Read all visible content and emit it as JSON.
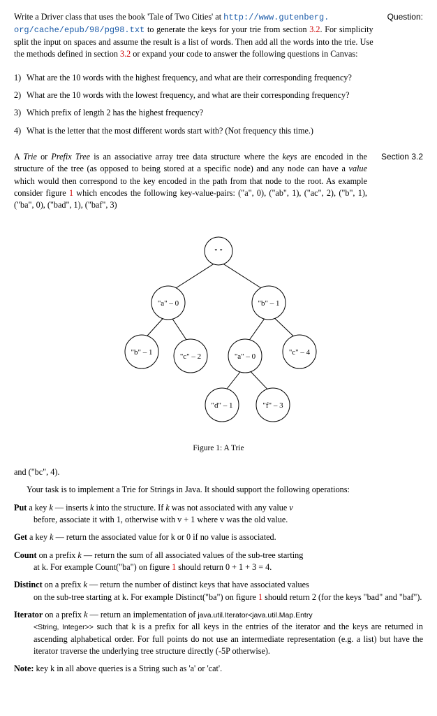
{
  "labels": {
    "question": "Question:",
    "section": "Section 3.2"
  },
  "intro": {
    "p1a": "Write a Driver class that uses the book 'Tale of Two Cities' at ",
    "url1": "http://www.gutenberg.",
    "url2": "org/cache/epub/98/pg98.txt",
    "p1b": " to generate the keys for your trie from section ",
    "ref": "3.2",
    "p1c": ". For simplicity split the input on spaces and assume the result is a list of words. Then add all the words into the trie. Use the methods defined in section ",
    "p1d": " or expand your code to answer the following questions in Canvas:"
  },
  "questions": {
    "q1n": "1)",
    "q1": "What are the 10 words with the highest frequency, and what are their corresponding frequency?",
    "q2n": "2)",
    "q2": "What are the 10 words with the lowest frequency, and what are their corresponding frequency?",
    "q3n": "3)",
    "q3": "Which prefix of length 2 has the highest frequency?",
    "q4n": "4)",
    "q4": "What is the letter that the most different words start with? (Not frequency this time.)"
  },
  "section32": {
    "p1a": "A ",
    "trie_it": "Trie",
    "p1b": " or ",
    "prefix_it": "Prefix Tree",
    "p1c": " is an associative array tree data structure where the ",
    "keys_it": "keys",
    "p1d": " are encoded in the structure of the tree (as opposed to being stored at a specific node) and any node can have a ",
    "value_it": "value",
    "p1e": " which would then correspond to the key encoded in the path from that node to the root. As example consider figure ",
    "fig_ref": "1",
    "p1f": " which encodes the following key-value-pairs: (\"a\", 0), (\"ab\", 1), (\"ac\", 2), (\"b\", 1), (\"ba\", 0), (\"bad\", 1), (\"baf\", 3)"
  },
  "figure": {
    "caption": "Figure 1: A Trie",
    "nodes": {
      "root": "\" \"",
      "a": "\"a\" – 0",
      "b": "\"b\" – 1",
      "ab": "\"b\" – 1",
      "ac": "\"c\" – 2",
      "ba": "\"a\" – 0",
      "bc": "\"c\" – 4",
      "bad": "\"d\" – 1",
      "baf": "\"f\" – 3"
    }
  },
  "after": {
    "p1": "and (\"bc\", 4).",
    "p2": "Your task is to implement a Trie for Strings in Java. It should support the following operations:"
  },
  "ops": {
    "put_head": "Put",
    "put_lead": " a key ",
    "put_k": "k",
    "put_dash": " — inserts ",
    "put_rest1": " into the structure. If ",
    "put_rest2": " was not associated with any value ",
    "put_v": "v",
    "put_body": "before, associate it with 1, otherwise with v + 1 where v was the old value.",
    "get_head": "Get",
    "get_lead": " a key ",
    "get_rest": " — return the associated value for k or 0 if no value is associated.",
    "count_head": "Count",
    "count_lead": " on a prefix ",
    "count_rest": " — return the sum of all associated values of the sub-tree starting",
    "count_body_a": "at k. For example Count(\"ba\") on figure ",
    "count_body_b": " should return 0 + 1 + 3 = 4.",
    "distinct_head": "Distinct",
    "distinct_rest": " — return the number of distinct keys that have associated values",
    "distinct_body_a": "on the sub-tree starting at k. For example Distinct(\"ba\") on figure ",
    "distinct_body_b": " should return 2 (for the keys \"bad\" and \"baf\").",
    "iter_head": "Iterator",
    "iter_rest_a": " — return an implementation of ",
    "iter_class": "java.util.Iterator<java.util.Map.Entry",
    "iter_body_a": "<String, Integer>>",
    "iter_body_b": " such that k is a prefix for all keys in the entries of the iterator and the keys are returned in ascending alphabetical order. For full points do not use an intermediate representation (e.g. a list) but have the iterator traverse the underlying tree structure directly (-5P otherwise).",
    "note_head": "Note:",
    "note_body": " key k in all above queries is a String such as 'a' or 'cat'."
  }
}
